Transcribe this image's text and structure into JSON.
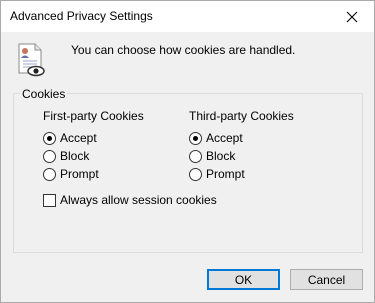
{
  "window": {
    "title": "Advanced Privacy Settings"
  },
  "intro": "You can choose how cookies are handled.",
  "group": {
    "label": "Cookies",
    "first_party": {
      "heading": "First-party Cookies",
      "options": [
        "Accept",
        "Block",
        "Prompt"
      ],
      "selected": "Accept"
    },
    "third_party": {
      "heading": "Third-party Cookies",
      "options": [
        "Accept",
        "Block",
        "Prompt"
      ],
      "selected": "Accept"
    },
    "session": {
      "label": "Always allow session cookies",
      "checked": false
    }
  },
  "buttons": {
    "ok": "OK",
    "cancel": "Cancel"
  },
  "icons": {
    "header": "privacy-report-icon",
    "close": "close-icon"
  },
  "colors": {
    "default_button_border": "#0078d7",
    "title_bar": "#ffffff",
    "dialog": "#f0f0f0"
  }
}
